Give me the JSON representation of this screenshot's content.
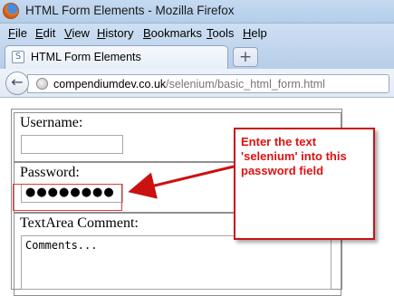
{
  "window": {
    "title": "HTML Form Elements - Mozilla Firefox"
  },
  "menu": [
    "File",
    "Edit",
    "View",
    "History",
    "Bookmarks",
    "Tools",
    "Help"
  ],
  "tab": {
    "title": "HTML Form Elements",
    "new_tab": "+"
  },
  "nav": {
    "back": "←",
    "url_domain": "compendiumdev.co.uk",
    "url_path": "/selenium/basic_html_form.html"
  },
  "form": {
    "username_label": "Username:",
    "username_value": "",
    "password_label": "Password:",
    "password_value": "●●●●●●●●",
    "textarea_label": "TextArea Comment:",
    "textarea_value": "Comments..."
  },
  "annotation": {
    "text": "Enter the text 'selenium' into this password field",
    "color": "#e01010"
  },
  "colors": {
    "annotation_border": "#cc1111",
    "highlight": "#e23b3b"
  },
  "icons": [
    "firefox-logo-icon",
    "page-icon",
    "back-arrow-icon",
    "globe-icon",
    "plus-icon"
  ]
}
